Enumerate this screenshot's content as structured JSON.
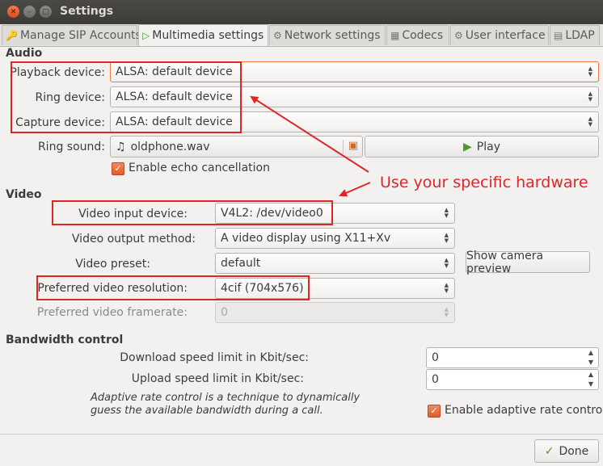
{
  "window": {
    "title": "Settings"
  },
  "tabs": [
    {
      "label": "Manage SIP Accounts",
      "icon": "key-icon"
    },
    {
      "label": "Multimedia settings",
      "icon": "play-icon"
    },
    {
      "label": "Network settings",
      "icon": "network-icon"
    },
    {
      "label": "Codecs",
      "icon": "codecs-icon"
    },
    {
      "label": "User interface",
      "icon": "gear-icon"
    },
    {
      "label": "LDAP",
      "icon": "ldap-icon"
    }
  ],
  "audio": {
    "section": "Audio",
    "playback_label": "Playback device:",
    "playback_value": "ALSA: default device",
    "ring_label": "Ring device:",
    "ring_value": "ALSA: default device",
    "capture_label": "Capture device:",
    "capture_value": "ALSA: default device",
    "ring_sound_label": "Ring sound:",
    "ring_sound_file": "oldphone.wav",
    "play_label": "Play",
    "echo_label": "Enable echo cancellation",
    "echo_checked": true
  },
  "video": {
    "section": "Video",
    "input_label": "Video input device:",
    "input_value": "V4L2: /dev/video0",
    "output_label": "Video output method:",
    "output_value": "A video display using X11+Xv",
    "preset_label": "Video preset:",
    "preset_value": "default",
    "camera_preview_label": "Show camera preview",
    "resolution_label": "Preferred video resolution:",
    "resolution_value": "4cif (704x576)",
    "framerate_label": "Preferred video framerate:",
    "framerate_value": "0"
  },
  "bandwidth": {
    "section": "Bandwidth control",
    "download_label": "Download speed limit in Kbit/sec:",
    "download_value": "0",
    "upload_label": "Upload speed limit in Kbit/sec:",
    "upload_value": "0",
    "adaptive_note": "Adaptive rate control is a technique to dynamically guess the available bandwidth during a call.",
    "adaptive_label": "Enable adaptive rate control",
    "adaptive_checked": true
  },
  "footer": {
    "done_label": "Done"
  },
  "annotation": {
    "text": "Use your specific hardware",
    "color": "#e02525"
  }
}
